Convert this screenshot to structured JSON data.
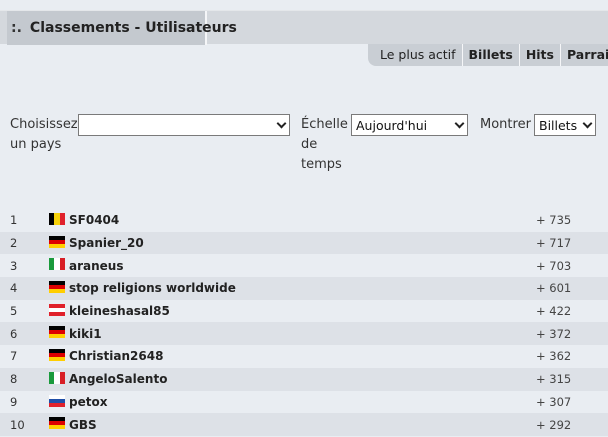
{
  "header": {
    "prefix": ":.",
    "title": "Classements - Utilisateurs"
  },
  "tabs": [
    {
      "label": "Le plus actif",
      "bold": false
    },
    {
      "label": "Billets",
      "bold": true
    },
    {
      "label": "Hits",
      "bold": true
    },
    {
      "label": "Parrains",
      "bold": true
    }
  ],
  "filters": {
    "country_label_1": "Choisissez",
    "country_label_2": "un pays",
    "country_value": "",
    "timescale_label_1": "Échelle",
    "timescale_label_2": "de",
    "timescale_label_3": "temps",
    "timescale_value": "Aujourd'hui",
    "show_label": "Montrer",
    "show_value": "Billets"
  },
  "ranking": [
    {
      "rank": "1",
      "user": "SF0404",
      "score": "+ 735",
      "flag": "belgium-flag",
      "colors": [
        "#000000",
        "#f5d10a",
        "#e0212b"
      ],
      "dir": "v"
    },
    {
      "rank": "2",
      "user": "Spanier_20",
      "score": "+ 717",
      "flag": "germany-flag",
      "colors": [
        "#000000",
        "#dd0000",
        "#ffce00"
      ],
      "dir": "h"
    },
    {
      "rank": "3",
      "user": "araneus",
      "score": "+ 703",
      "flag": "italy-flag",
      "colors": [
        "#1a9a3c",
        "#ffffff",
        "#d81e25"
      ],
      "dir": "v"
    },
    {
      "rank": "4",
      "user": "stop religions worldwide",
      "score": "+ 601",
      "flag": "germany-flag",
      "colors": [
        "#000000",
        "#dd0000",
        "#ffce00"
      ],
      "dir": "h"
    },
    {
      "rank": "5",
      "user": "kleineshasal85",
      "score": "+ 422",
      "flag": "austria-flag",
      "colors": [
        "#e0212b",
        "#ffffff",
        "#e0212b"
      ],
      "dir": "h"
    },
    {
      "rank": "6",
      "user": "kiki1",
      "score": "+ 372",
      "flag": "germany-flag",
      "colors": [
        "#000000",
        "#dd0000",
        "#ffce00"
      ],
      "dir": "h"
    },
    {
      "rank": "7",
      "user": "Christian2648",
      "score": "+ 362",
      "flag": "germany-flag",
      "colors": [
        "#000000",
        "#dd0000",
        "#ffce00"
      ],
      "dir": "h"
    },
    {
      "rank": "8",
      "user": "AngeloSalento",
      "score": "+ 315",
      "flag": "italy-flag",
      "colors": [
        "#1a9a3c",
        "#ffffff",
        "#d81e25"
      ],
      "dir": "v"
    },
    {
      "rank": "9",
      "user": "petox",
      "score": "+ 307",
      "flag": "slovenia-flag",
      "colors": [
        "#ffffff",
        "#1f4fa8",
        "#e0212b"
      ],
      "dir": "h"
    },
    {
      "rank": "10",
      "user": "GBS",
      "score": "+ 292",
      "flag": "germany-flag",
      "colors": [
        "#000000",
        "#dd0000",
        "#ffce00"
      ],
      "dir": "h"
    }
  ]
}
